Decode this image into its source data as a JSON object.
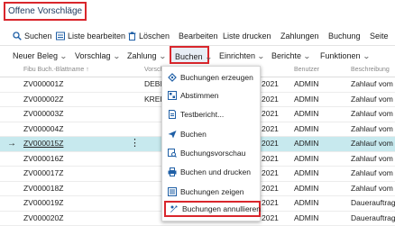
{
  "page": {
    "title": "Offene Vorschläge"
  },
  "toolbar": {
    "search": "Suchen",
    "edit_list": "Liste bearbeiten",
    "delete": "Löschen",
    "edit": "Bearbeiten",
    "print_list": "Liste drucken",
    "payments": "Zahlungen",
    "posting": "Buchung",
    "page": "Seite"
  },
  "actionbar": {
    "new_entry": "Neuer Beleg",
    "proposal": "Vorschlag",
    "payment": "Zahlung",
    "post": "Buchen",
    "setup": "Einrichten",
    "reports": "Berichte",
    "functions": "Funktionen"
  },
  "table": {
    "headers": {
      "col1": "Fibu Buch.-Blattname ↑",
      "col2": "Vorschla",
      "col3": "Benutzer",
      "col4": "Beschreibung"
    },
    "rows": [
      {
        "id": "ZV000001Z",
        "type": "DEBITO",
        "year": "2021",
        "user": "ADMIN",
        "desc": "Zahlauf vom"
      },
      {
        "id": "ZV000002Z",
        "type": "KREDIT",
        "year": "2021",
        "user": "ADMIN",
        "desc": "Zahlauf vom"
      },
      {
        "id": "ZV000003Z",
        "type": "",
        "year": "2021",
        "user": "ADMIN",
        "desc": "Zahlauf vom"
      },
      {
        "id": "ZV000004Z",
        "type": "",
        "year": "2021",
        "user": "ADMIN",
        "desc": "Zahlauf vom"
      },
      {
        "id": "ZV000015Z",
        "type": "",
        "year": "2021",
        "user": "ADMIN",
        "desc": "Zahlauf vom"
      },
      {
        "id": "ZV000016Z",
        "type": "",
        "year": "2021",
        "user": "ADMIN",
        "desc": "Zahlauf vom"
      },
      {
        "id": "ZV000017Z",
        "type": "",
        "year": "2021",
        "user": "ADMIN",
        "desc": "Zahlauf vom"
      },
      {
        "id": "ZV000018Z",
        "type": "",
        "year": "2021",
        "user": "ADMIN",
        "desc": "Zahlauf vom"
      },
      {
        "id": "ZV000019Z",
        "type": "",
        "year": "2021",
        "user": "ADMIN",
        "desc": "Dauerauftrag"
      },
      {
        "id": "ZV000020Z",
        "type": "",
        "year": "2021",
        "user": "ADMIN",
        "desc": "Dauerauftrag"
      }
    ]
  },
  "menu": {
    "items": [
      {
        "label": "Buchungen erzeugen"
      },
      {
        "label": "Abstimmen"
      },
      {
        "label": "Testbericht..."
      },
      {
        "label": "Buchen"
      },
      {
        "label": "Buchungsvorschau"
      },
      {
        "label": "Buchen und drucken"
      },
      {
        "label": "Buchungen zeigen"
      },
      {
        "label": "Buchungen annullieren"
      }
    ]
  },
  "colors": {
    "accent": "#d9262c",
    "selected_row": "#c7e9ee",
    "icon_blue": "#1f5fa6"
  }
}
